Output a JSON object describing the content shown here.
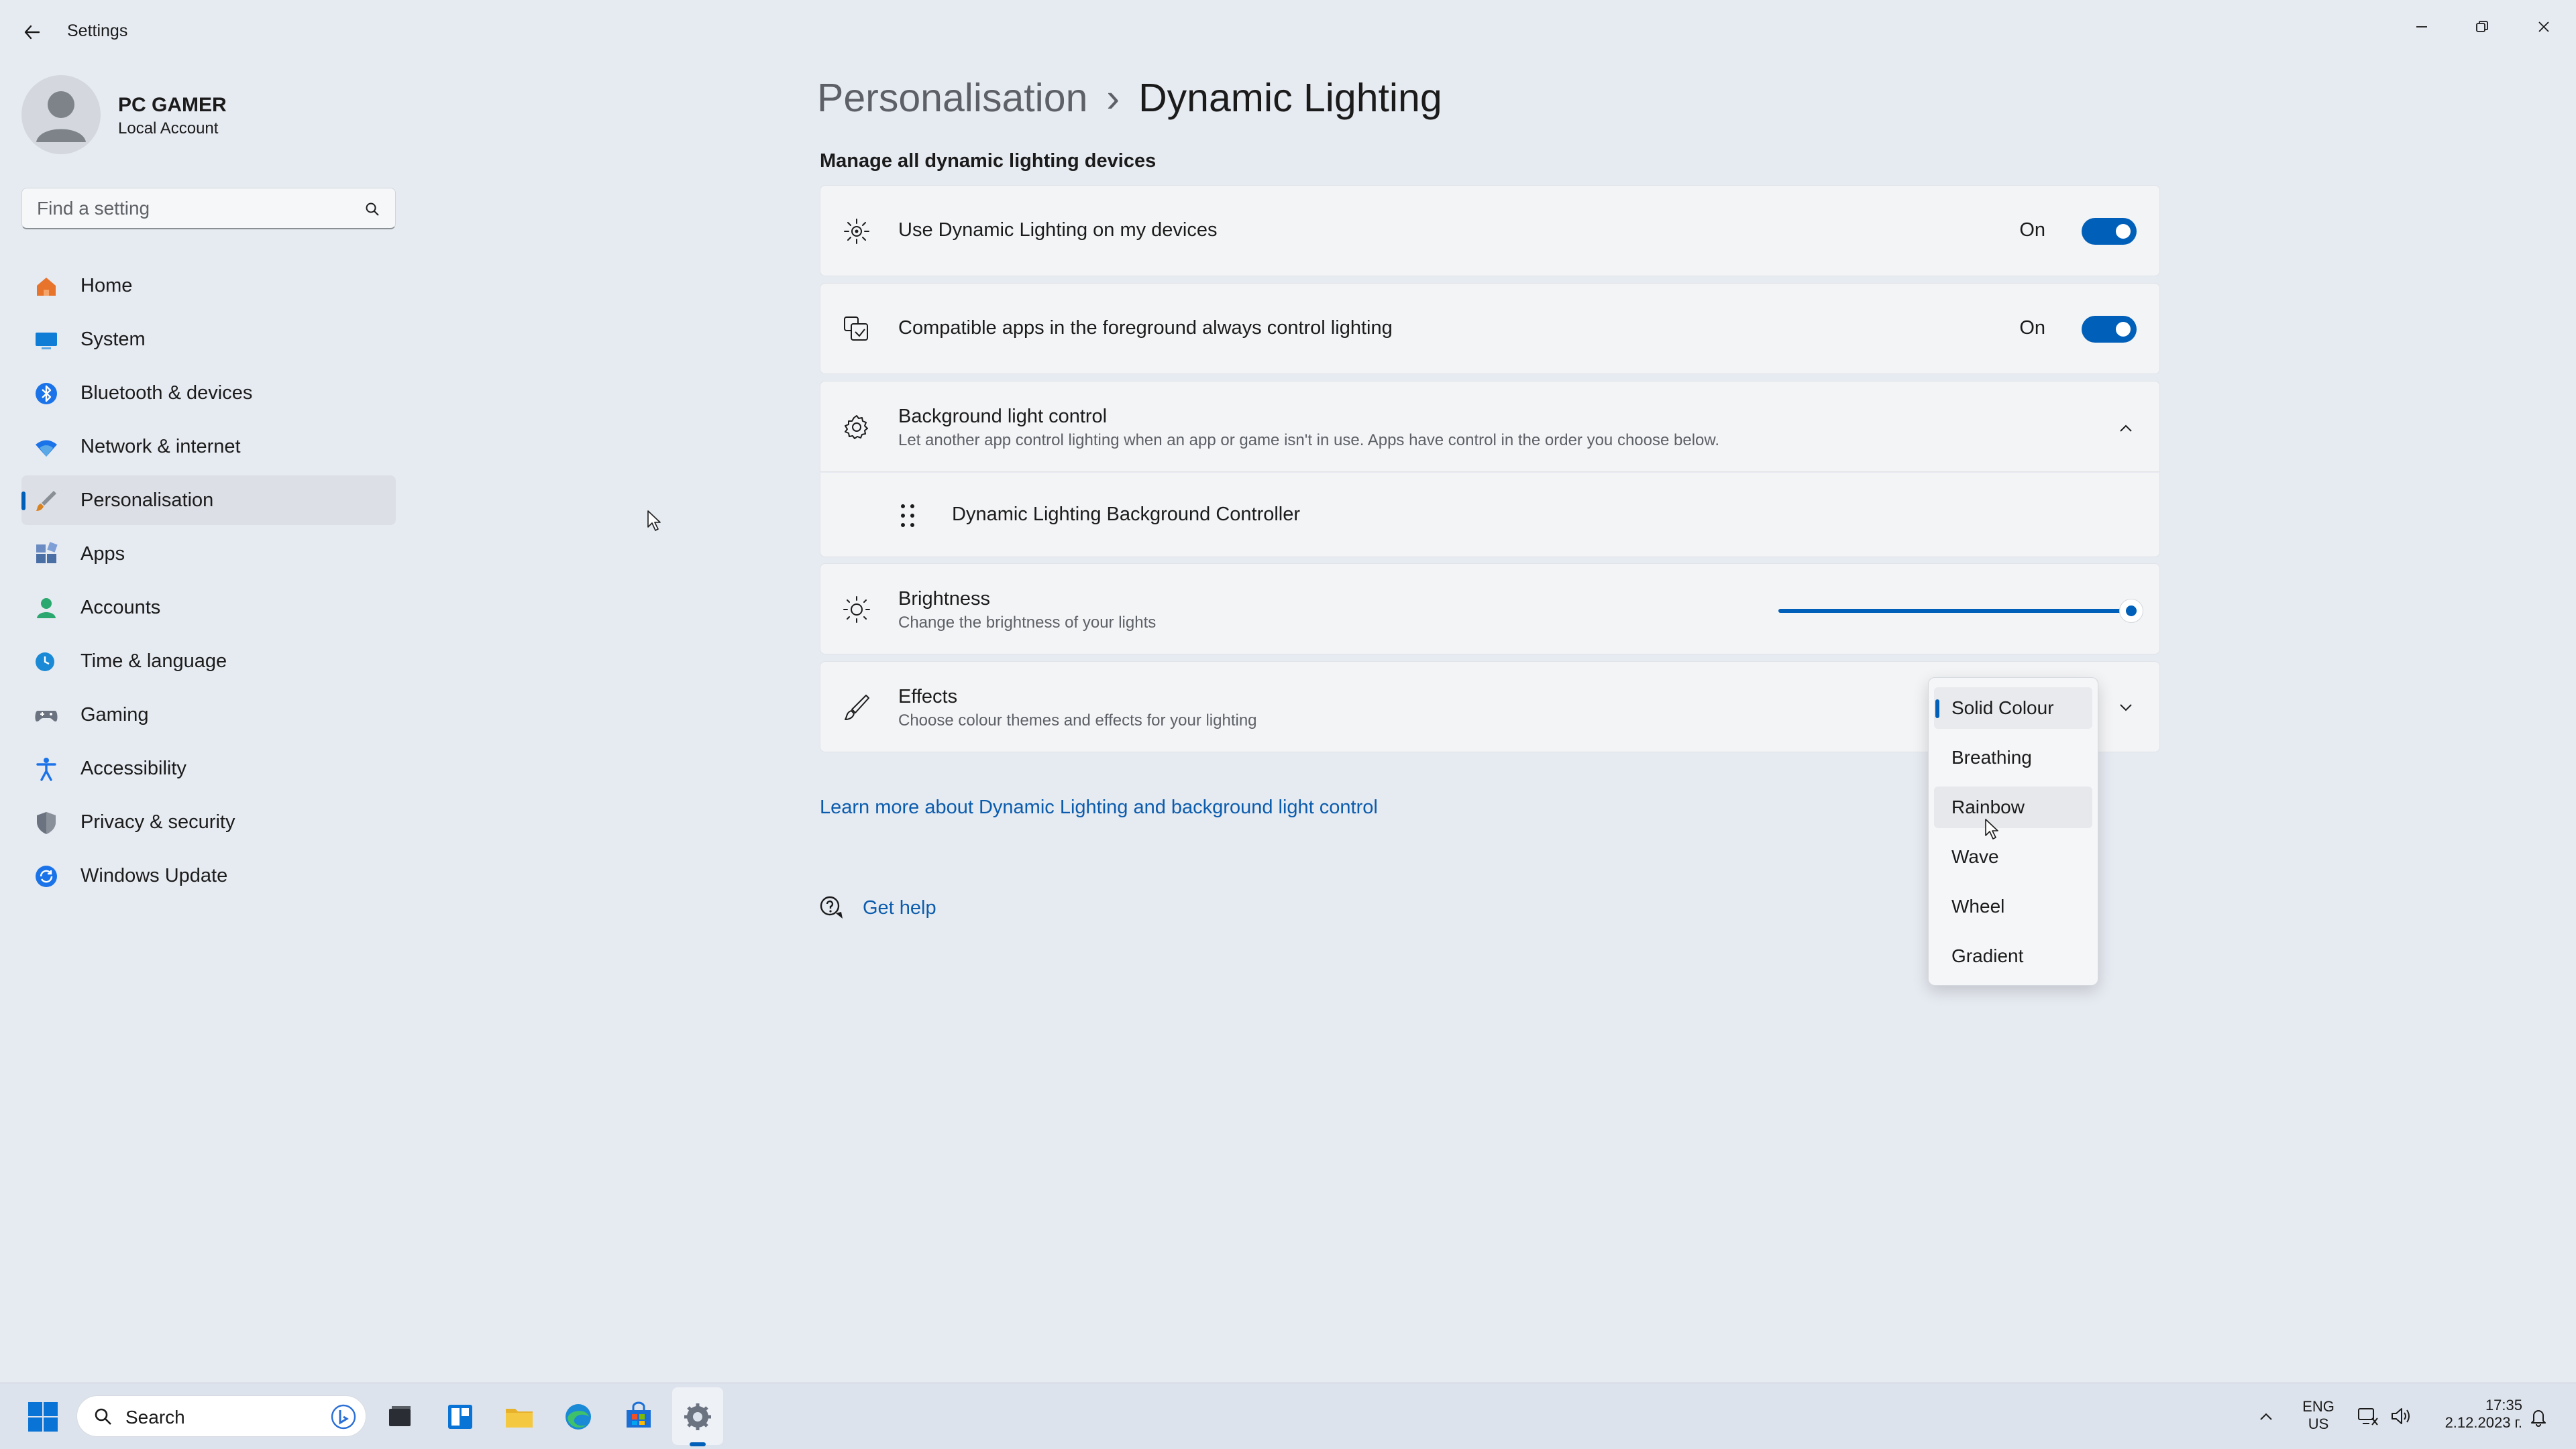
{
  "window": {
    "title": "Settings"
  },
  "profile": {
    "name": "PC GAMER",
    "account_type": "Local Account"
  },
  "search": {
    "placeholder": "Find a setting"
  },
  "sidebar": {
    "items": [
      {
        "label": "Home",
        "icon": "home-icon",
        "color": "#e8732a"
      },
      {
        "label": "System",
        "icon": "monitor-icon",
        "color": "#0f7cd6"
      },
      {
        "label": "Bluetooth & devices",
        "icon": "bluetooth-icon",
        "color": "#1a73e8"
      },
      {
        "label": "Network & internet",
        "icon": "wifi-icon",
        "color": "#1a73e8"
      },
      {
        "label": "Personalisation",
        "icon": "brush-icon",
        "color": "#d98220",
        "selected": true
      },
      {
        "label": "Apps",
        "icon": "apps-icon",
        "color": "#4a6fa5"
      },
      {
        "label": "Accounts",
        "icon": "person-icon",
        "color": "#2aa86f"
      },
      {
        "label": "Time & language",
        "icon": "globe-clock-icon",
        "color": "#1a8ad6"
      },
      {
        "label": "Gaming",
        "icon": "gamepad-icon",
        "color": "#6b7380"
      },
      {
        "label": "Accessibility",
        "icon": "accessibility-icon",
        "color": "#1a73e8"
      },
      {
        "label": "Privacy & security",
        "icon": "shield-icon",
        "color": "#6b7380"
      },
      {
        "label": "Windows Update",
        "icon": "update-icon",
        "color": "#1a73e8"
      }
    ]
  },
  "breadcrumb": {
    "parent": "Personalisation",
    "separator": "›",
    "current": "Dynamic Lighting"
  },
  "section_title": "Manage all dynamic lighting devices",
  "settings": {
    "use_dynamic": {
      "title": "Use Dynamic Lighting on my devices",
      "state": "On",
      "on": true
    },
    "compatible_apps": {
      "title": "Compatible apps in the foreground always control lighting",
      "state": "On",
      "on": true
    },
    "background_control": {
      "title": "Background light control",
      "description": "Let another app control lighting when an app or game isn't in use. Apps have control in the order you choose below.",
      "expanded": true,
      "controllers": [
        "Dynamic Lighting Background Controller"
      ]
    },
    "brightness": {
      "title": "Brightness",
      "description": "Change the brightness of your lights",
      "value": 100
    },
    "effects": {
      "title": "Effects",
      "description": "Choose colour themes and effects for your lighting",
      "selected": "Solid Colour",
      "hovered": "Rainbow",
      "options": [
        "Solid Colour",
        "Breathing",
        "Rainbow",
        "Wave",
        "Wheel",
        "Gradient"
      ]
    }
  },
  "links": {
    "learn_more": "Learn more about Dynamic Lighting and background light control",
    "get_help": "Get help"
  },
  "taskbar": {
    "search_label": "Search",
    "language": "ENG",
    "region": "US",
    "time": "17:35",
    "date": "2.12.2023 г."
  },
  "accent_color": "#005fb8"
}
